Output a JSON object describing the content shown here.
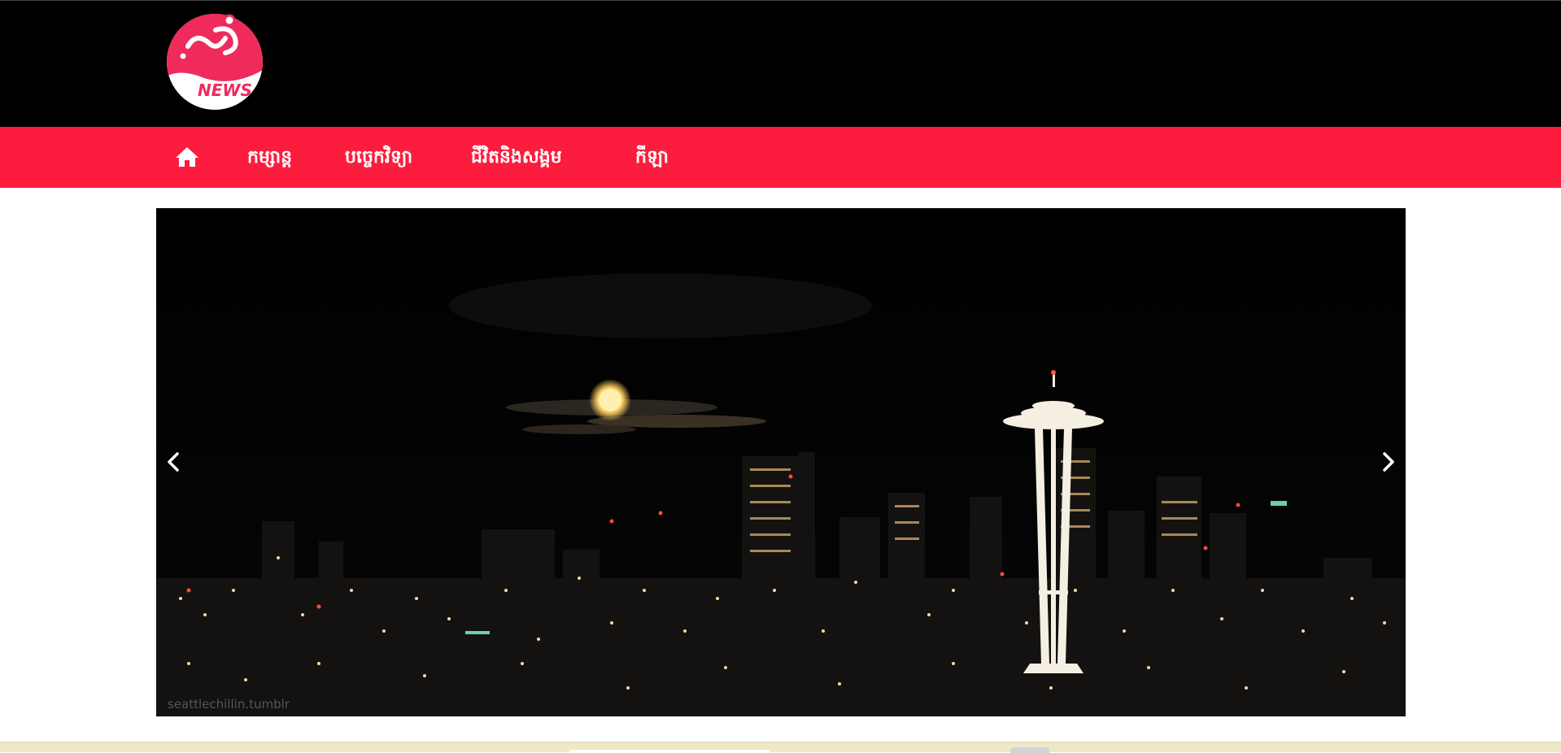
{
  "header": {
    "logo_text": "NEWS"
  },
  "nav": {
    "home_icon": "home-icon",
    "items": [
      {
        "label": "កម្សាន្ត"
      },
      {
        "label": "បច្ចេកវិទ្យា"
      },
      {
        "label": "ជីវិតនិងសង្គម"
      },
      {
        "label": "កីឡា"
      }
    ]
  },
  "slider": {
    "watermark": "seattlechillin.tumblr",
    "prev_icon": "chevron-left-icon",
    "next_icon": "chevron-right-icon"
  },
  "colors": {
    "header_bg": "#000000",
    "nav_bg": "#fc1c3e",
    "logo_pink": "#ef2b5c",
    "footer_strip": "#efe8c8"
  }
}
